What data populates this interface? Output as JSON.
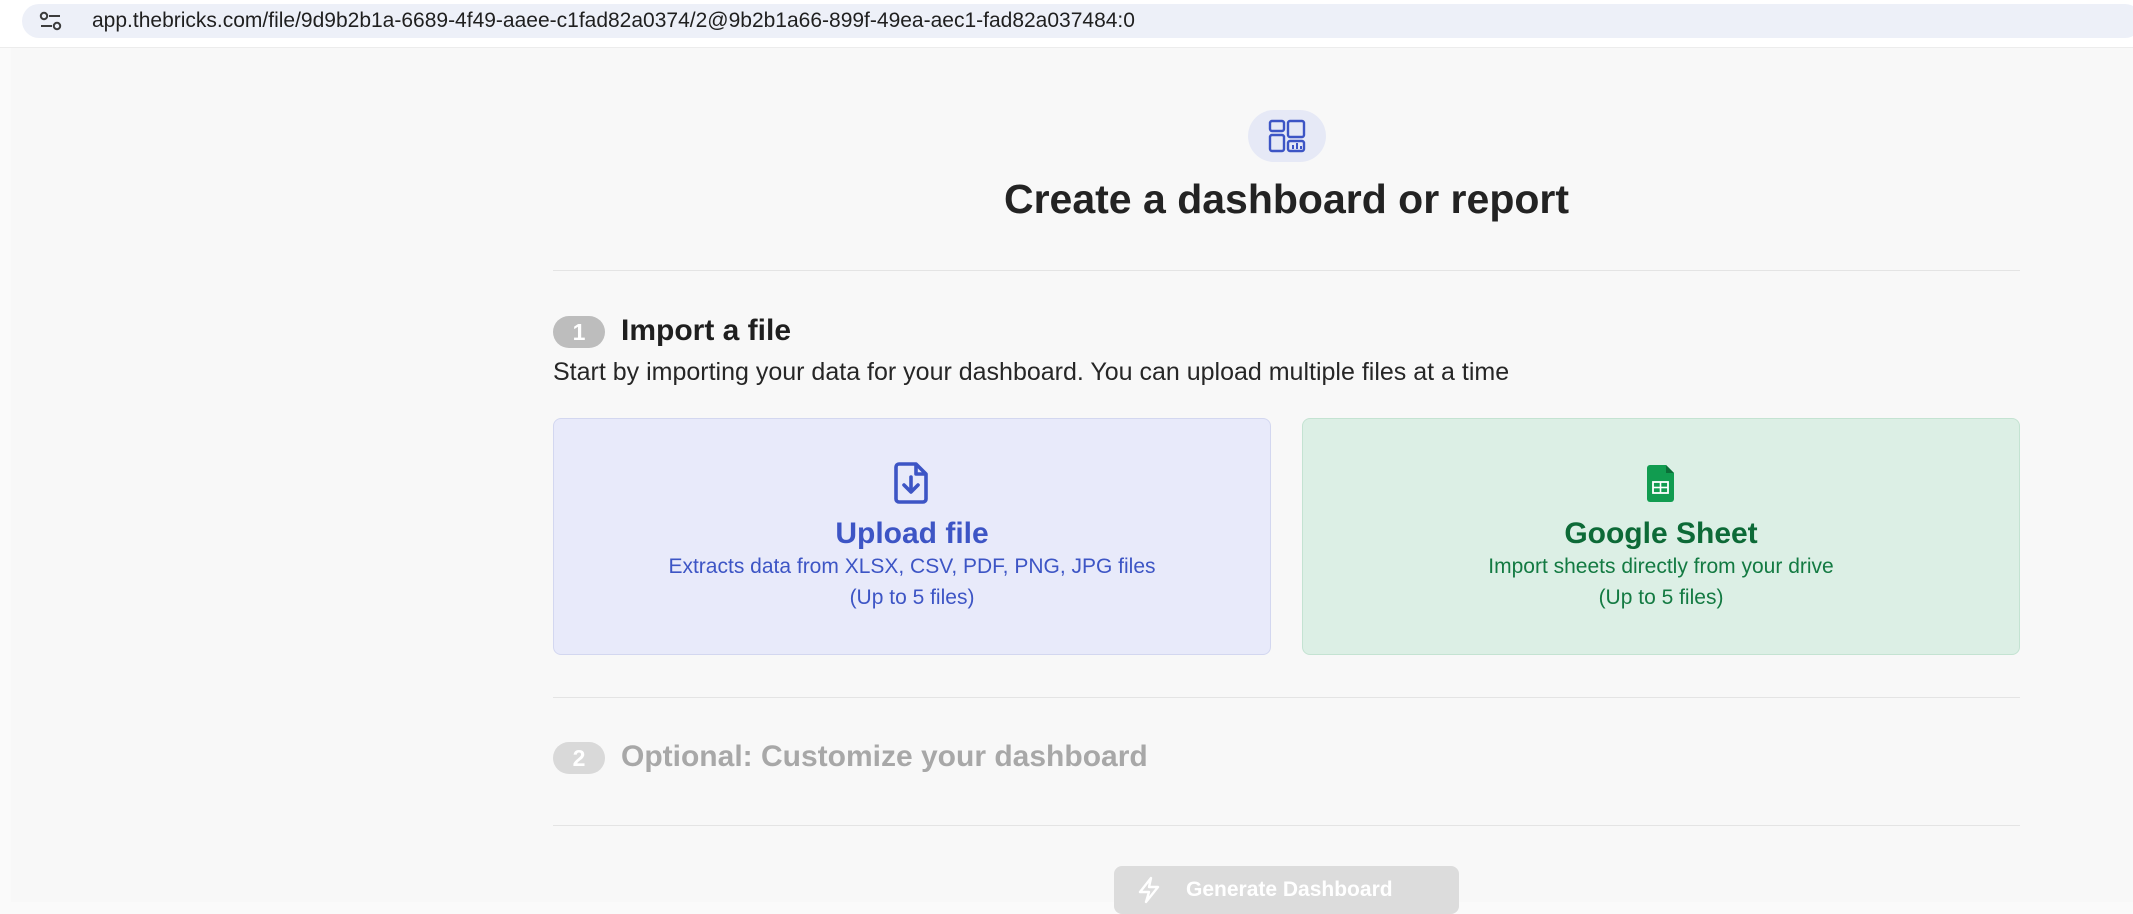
{
  "browser": {
    "url": "app.thebricks.com/file/9d9b2b1a-6689-4f49-aaee-c1fad82a0374/2@9b2b1a66-899f-49ea-aec1-fad82a037484:0",
    "site_info_icon": "tune-icon"
  },
  "header": {
    "icon": "dashboard-icon",
    "title": "Create a dashboard or report"
  },
  "step1": {
    "number": "1",
    "title": "Import a file",
    "description": "Start by importing your data for your dashboard. You can upload multiple files at a time"
  },
  "cards": {
    "upload": {
      "icon": "file-download-icon",
      "title": "Upload file",
      "line1": "Extracts data from XLSX, CSV, PDF, PNG, JPG files",
      "line2": "(Up to 5 files)"
    },
    "sheet": {
      "icon": "google-sheets-icon",
      "title": "Google Sheet",
      "line1": "Import sheets directly from your drive",
      "line2": "(Up to 5 files)"
    }
  },
  "step2": {
    "number": "2",
    "title": "Optional: Customize your dashboard"
  },
  "generate": {
    "icon": "bolt-icon",
    "label": "Generate Dashboard"
  },
  "colors": {
    "upload_accent": "#3d55c5",
    "sheet_accent": "#137a42",
    "badge_active": "#bdbdbd",
    "badge_inactive": "#d9d9d9"
  }
}
